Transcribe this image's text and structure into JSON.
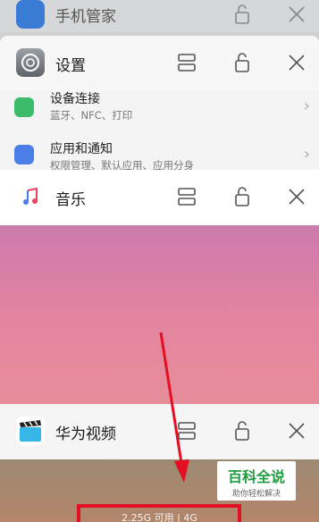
{
  "cards": {
    "phone_manager": {
      "name": "手机管家"
    },
    "settings": {
      "name": "设置",
      "rows": [
        {
          "title": "设备连接",
          "subtitle": "蓝牙、NFC、打印"
        },
        {
          "title": "应用和通知",
          "subtitle": "权限管理、默认应用、应用分身"
        }
      ]
    },
    "music": {
      "name": "音乐"
    },
    "video": {
      "name": "华为视频"
    }
  },
  "memory_status": "2.25G 可用 | 4G",
  "watermark": {
    "title": "百科全说",
    "subtitle": "助你轻松解决"
  },
  "colors": {
    "highlight": "#e50f23",
    "music_gradient_top": "#b77aa8",
    "music_gradient_bottom": "#e78f9a"
  }
}
